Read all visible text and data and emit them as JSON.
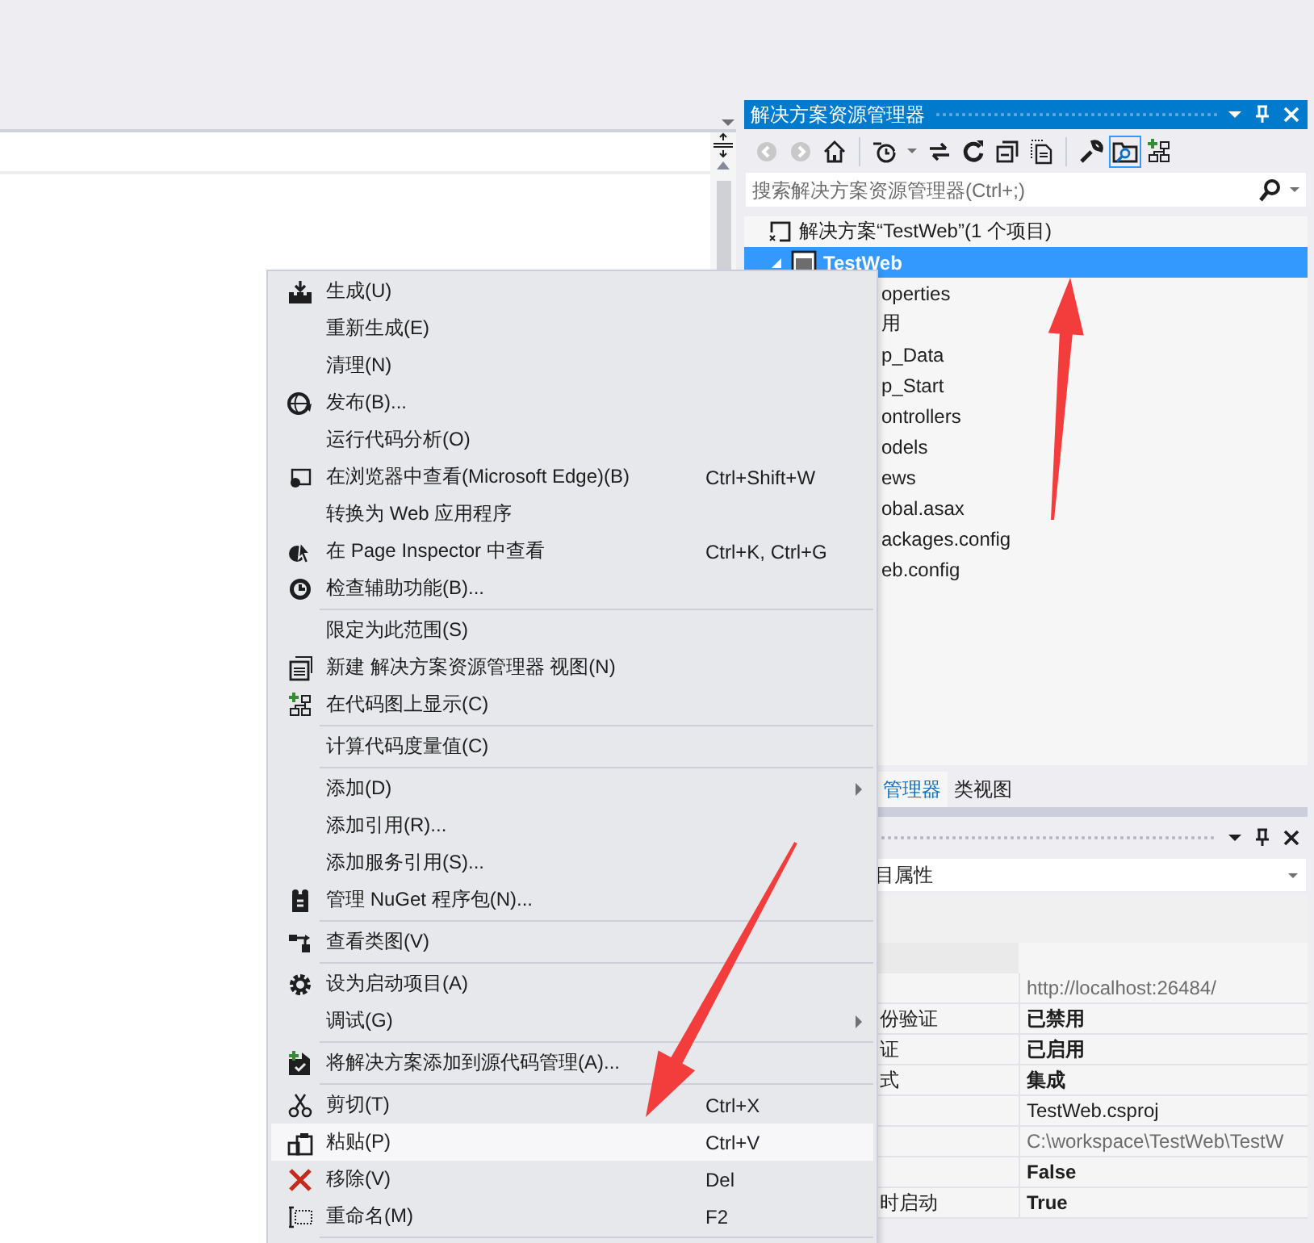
{
  "explorer": {
    "title": "解决方案资源管理器",
    "search": {
      "placeholder": "搜索解决方案资源管理器(Ctrl+;)"
    },
    "tree": [
      {
        "label": "解决方案“TestWeb”(1 个项目)",
        "selected": false,
        "children": [
          {
            "label": "TestWeb",
            "selected": true,
            "expanded": true,
            "children": [
              {
                "label": "operties",
                "selected": false
              },
              {
                "label": "用",
                "selected": false
              },
              {
                "label": "p_Data",
                "selected": false
              },
              {
                "label": "p_Start",
                "selected": false
              },
              {
                "label": "ontrollers",
                "selected": false
              },
              {
                "label": "odels",
                "selected": false
              },
              {
                "label": "ews",
                "selected": false
              },
              {
                "label": "obal.asax",
                "selected": false
              },
              {
                "label": "ackages.config",
                "selected": false
              },
              {
                "label": "eb.config",
                "selected": false
              }
            ]
          }
        ]
      }
    ]
  },
  "properties": {
    "tabs": [
      {
        "label": "管理器",
        "selected": true
      },
      {
        "label": "类视图",
        "selected": false
      }
    ],
    "object": "目属性",
    "rows": [
      {
        "value": "http://localhost:26484/",
        "kind": "readonly"
      },
      {
        "name": "份验证",
        "value": "已禁用",
        "kind": "changed"
      },
      {
        "name": "证",
        "value": "已启用",
        "kind": "changed"
      },
      {
        "name": "式",
        "value": "集成",
        "kind": "changed"
      },
      {
        "value": "TestWeb.csproj",
        "kind": "normal"
      },
      {
        "value": "C:\\workspace\\TestWeb\\TestW",
        "kind": "readonly"
      },
      {
        "value": "False",
        "kind": "changed"
      },
      {
        "name": "时启动",
        "value": "True",
        "kind": "changed"
      }
    ]
  },
  "menu": {
    "items": [
      {
        "kind": "item",
        "label": "生成(U)",
        "submenu": false,
        "selected": false
      },
      {
        "kind": "item",
        "label": "重新生成(E)",
        "submenu": false,
        "selected": false
      },
      {
        "kind": "item",
        "label": "清理(N)",
        "submenu": false,
        "selected": false
      },
      {
        "kind": "item",
        "label": "发布(B)...",
        "submenu": false,
        "selected": false
      },
      {
        "kind": "item",
        "label": "运行代码分析(O)",
        "submenu": false,
        "selected": false
      },
      {
        "kind": "item",
        "label": "在浏览器中查看(Microsoft Edge)(B)",
        "shortcut": "Ctrl+Shift+W",
        "submenu": false,
        "selected": false
      },
      {
        "kind": "item",
        "label": "转换为 Web 应用程序",
        "submenu": false,
        "selected": false
      },
      {
        "kind": "item",
        "label": "在 Page Inspector 中查看",
        "shortcut": "Ctrl+K, Ctrl+G",
        "submenu": false,
        "selected": false
      },
      {
        "kind": "item",
        "label": "检查辅助功能(B)...",
        "submenu": false,
        "selected": false
      },
      {
        "kind": "separator"
      },
      {
        "kind": "item",
        "label": "限定为此范围(S)",
        "submenu": false,
        "selected": false
      },
      {
        "kind": "item",
        "label": "新建 解决方案资源管理器 视图(N)",
        "submenu": false,
        "selected": false
      },
      {
        "kind": "item",
        "label": "在代码图上显示(C)",
        "submenu": false,
        "selected": false
      },
      {
        "kind": "separator"
      },
      {
        "kind": "item",
        "label": "计算代码度量值(C)",
        "submenu": false,
        "selected": false
      },
      {
        "kind": "separator"
      },
      {
        "kind": "item",
        "label": "添加(D)",
        "submenu": true,
        "selected": false
      },
      {
        "kind": "item",
        "label": "添加引用(R)...",
        "submenu": false,
        "selected": false
      },
      {
        "kind": "item",
        "label": "添加服务引用(S)...",
        "submenu": false,
        "selected": false
      },
      {
        "kind": "item",
        "label": "管理 NuGet 程序包(N)...",
        "submenu": false,
        "selected": false
      },
      {
        "kind": "separator"
      },
      {
        "kind": "item",
        "label": "查看类图(V)",
        "submenu": false,
        "selected": false
      },
      {
        "kind": "separator"
      },
      {
        "kind": "item",
        "label": "设为启动项目(A)",
        "submenu": false,
        "selected": false
      },
      {
        "kind": "item",
        "label": "调试(G)",
        "submenu": true,
        "selected": false
      },
      {
        "kind": "separator"
      },
      {
        "kind": "item",
        "label": "将解决方案添加到源代码管理(A)...",
        "submenu": false,
        "selected": false
      },
      {
        "kind": "separator"
      },
      {
        "kind": "item",
        "label": "剪切(T)",
        "shortcut": "Ctrl+X",
        "submenu": false,
        "selected": false
      },
      {
        "kind": "item",
        "label": "粘贴(P)",
        "shortcut": "Ctrl+V",
        "submenu": false,
        "selected": true
      },
      {
        "kind": "item",
        "label": "移除(V)",
        "shortcut": "Del",
        "submenu": false,
        "selected": false
      },
      {
        "kind": "item",
        "label": "重命名(M)",
        "shortcut": "F2",
        "submenu": false,
        "selected": false
      },
      {
        "kind": "separator"
      }
    ]
  }
}
